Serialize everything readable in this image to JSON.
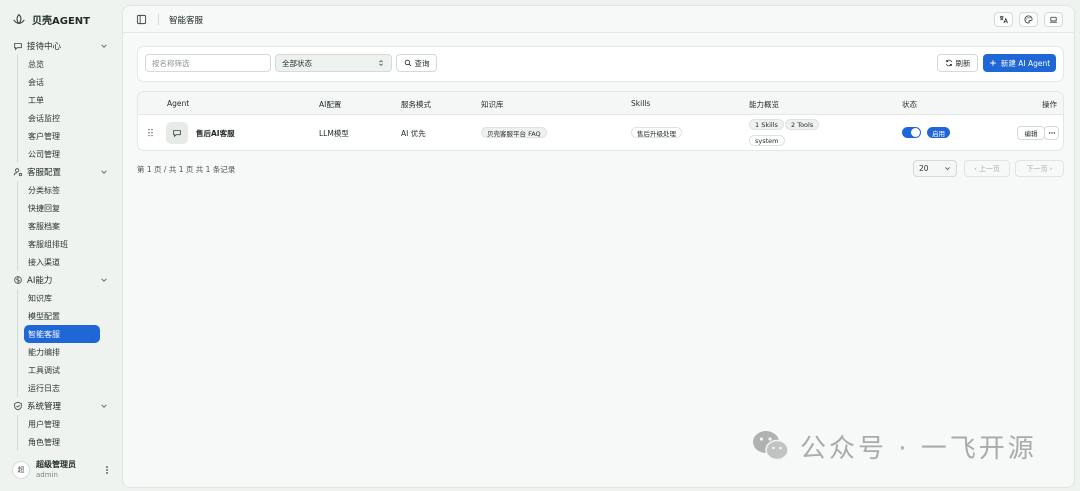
{
  "app": {
    "brand": "贝壳AGENT"
  },
  "sidebar": {
    "groups": [
      {
        "label": "接待中心",
        "icon": "chat-bubble-icon",
        "items": [
          "总览",
          "会话",
          "工单",
          "会话监控",
          "客户管理",
          "公司管理"
        ]
      },
      {
        "label": "客服配置",
        "icon": "user-gear-icon",
        "items": [
          "分类标签",
          "快捷回复",
          "客服档案",
          "客服组排班",
          "接入渠道"
        ]
      },
      {
        "label": "AI能力",
        "icon": "ai-brain-icon",
        "items": [
          "知识库",
          "模型配置",
          "智能客服",
          "能力编排",
          "工具调试",
          "运行日志"
        ]
      },
      {
        "label": "系统管理",
        "icon": "shield-icon",
        "items": [
          "用户管理",
          "角色管理"
        ]
      }
    ],
    "active_item": "智能客服",
    "user": {
      "avatar_text": "超",
      "name": "超级管理员",
      "role": "admin"
    }
  },
  "header": {
    "title": "智能客服"
  },
  "filters": {
    "search_placeholder": "按名称筛选",
    "status_value": "全部状态",
    "query_label": "查询",
    "refresh_label": "刷新",
    "new_label": "新建 AI Agent"
  },
  "table": {
    "columns": [
      "Agent",
      "AI配置",
      "服务模式",
      "知识库",
      "Skills",
      "能力概览",
      "状态",
      "操作"
    ],
    "rows": [
      {
        "agent": "售后AI客服",
        "ai_config": "LLM模型",
        "service_mode": "AI 优先",
        "knowledge": "贝壳客服平台 FAQ",
        "skills": "售后升级处理",
        "capabilities": [
          "1 Skills",
          "2 Tools",
          "system"
        ],
        "status": "启用",
        "enabled": true,
        "edit_label": "编辑"
      }
    ]
  },
  "pagination": {
    "info": "第 1 页 / 共 1 页  共 1 条记录",
    "page_size": "20",
    "prev_label": "上一页",
    "next_label": "下一页"
  },
  "watermark": {
    "text": "公众号 · 一飞开源"
  },
  "colors": {
    "accent": "#1f66d6",
    "background": "#eef3f0",
    "card": "#ffffff"
  }
}
